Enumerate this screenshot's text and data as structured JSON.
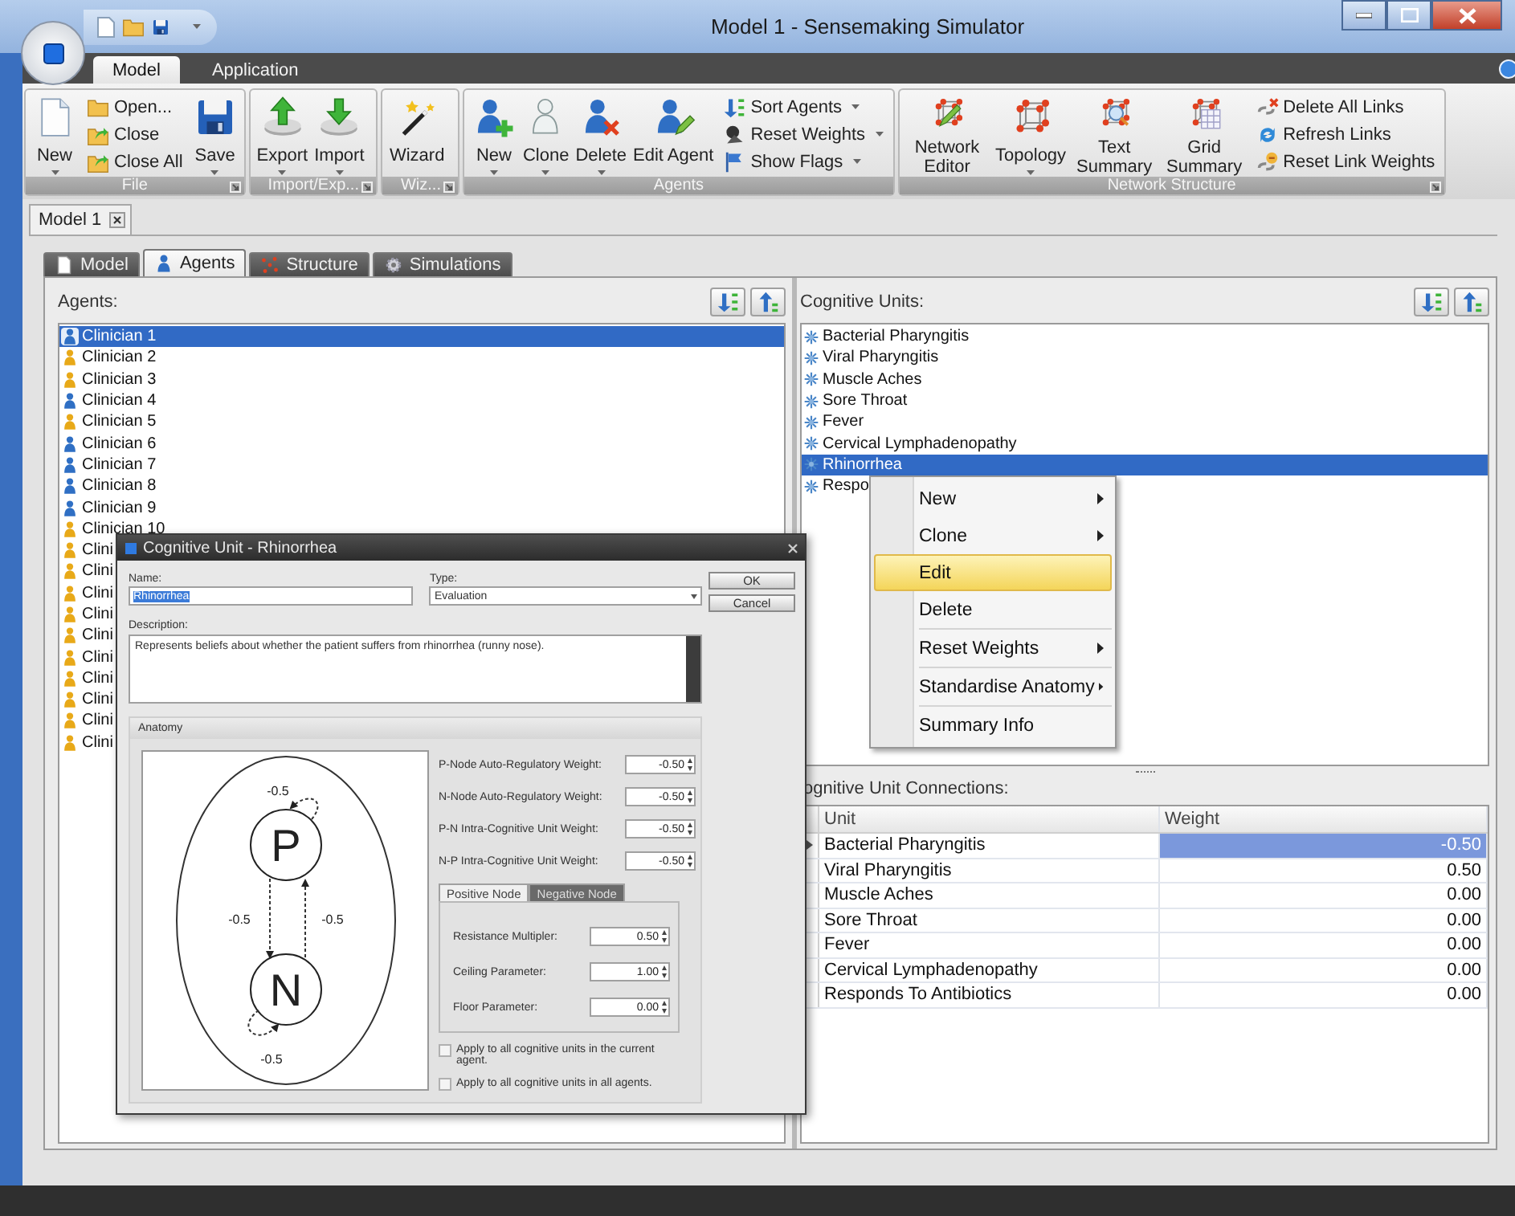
{
  "window": {
    "title": "Model 1 - Sensemaking Simulator"
  },
  "ribbon_tabs": [
    {
      "label": "Model",
      "selected": true
    },
    {
      "label": "Application",
      "selected": false
    }
  ],
  "ribbon_groups": [
    {
      "title": "File",
      "launcher": true,
      "items": [
        {
          "kind": "large",
          "label": "New",
          "dropdown": true
        },
        {
          "kind": "stack",
          "items": [
            {
              "label": "Open...",
              "dropdown": false
            },
            {
              "label": "Close",
              "dropdown": false
            },
            {
              "label": "Close All",
              "dropdown": false
            }
          ]
        },
        {
          "kind": "large",
          "label": "Save",
          "dropdown": true
        }
      ]
    },
    {
      "title": "Import/Exp...",
      "launcher": true,
      "items": [
        {
          "kind": "large",
          "label": "Export",
          "dropdown": true
        },
        {
          "kind": "large",
          "label": "Import",
          "dropdown": true
        }
      ]
    },
    {
      "title": "Wiz...",
      "launcher": true,
      "items": [
        {
          "kind": "large",
          "label": "Wizard",
          "dropdown": false
        }
      ]
    },
    {
      "title": "Agents",
      "launcher": false,
      "items": [
        {
          "kind": "large",
          "label": "New",
          "dropdown": true
        },
        {
          "kind": "large",
          "label": "Clone",
          "dropdown": true
        },
        {
          "kind": "large",
          "label": "Delete",
          "dropdown": true
        },
        {
          "kind": "large",
          "label": "Edit Agent",
          "dropdown": false
        },
        {
          "kind": "stack",
          "items": [
            {
              "label": "Sort Agents",
              "dropdown": true
            },
            {
              "label": "Reset Weights",
              "dropdown": true
            },
            {
              "label": "Show Flags",
              "dropdown": true
            }
          ]
        }
      ]
    },
    {
      "title": "Network Structure",
      "launcher": true,
      "items": [
        {
          "kind": "large",
          "label": "Network Editor",
          "dropdown": false
        },
        {
          "kind": "large",
          "label": "Topology",
          "dropdown": true
        },
        {
          "kind": "large",
          "label": "Text Summary",
          "dropdown": false
        },
        {
          "kind": "large",
          "label": "Grid Summary",
          "dropdown": false
        },
        {
          "kind": "stack",
          "items": [
            {
              "label": "Delete All Links",
              "dropdown": false
            },
            {
              "label": "Refresh Links",
              "dropdown": false
            },
            {
              "label": "Reset Link Weights",
              "dropdown": false
            }
          ]
        }
      ]
    }
  ],
  "document_tabs": [
    {
      "label": "Model 1",
      "selected": true
    }
  ],
  "view_tabs": [
    {
      "label": "Model",
      "selected": false
    },
    {
      "label": "Agents",
      "selected": true
    },
    {
      "label": "Structure",
      "selected": false
    },
    {
      "label": "Simulations",
      "selected": false
    }
  ],
  "agents": {
    "label": "Agents:",
    "items": [
      {
        "label": "Clinician 1",
        "color": "#2f6fc4",
        "selected": true
      },
      {
        "label": "Clinician 2",
        "color": "#e8a918",
        "selected": false
      },
      {
        "label": "Clinician 3",
        "color": "#e8a918",
        "selected": false
      },
      {
        "label": "Clinician 4",
        "color": "#2f6fc4",
        "selected": false
      },
      {
        "label": "Clinician 5",
        "color": "#e8a918",
        "selected": false
      },
      {
        "label": "Clinician 6",
        "color": "#2f6fc4",
        "selected": false
      },
      {
        "label": "Clinician 7",
        "color": "#2f6fc4",
        "selected": false
      },
      {
        "label": "Clinician 8",
        "color": "#2f6fc4",
        "selected": false
      },
      {
        "label": "Clinician 9",
        "color": "#2f6fc4",
        "selected": false
      },
      {
        "label": "Clinician 10",
        "color": "#e8a918",
        "selected": false
      },
      {
        "label": "Clini",
        "color": "#e8a918",
        "selected": false
      },
      {
        "label": "Clini",
        "color": "#e8a918",
        "selected": false
      },
      {
        "label": "Clini",
        "color": "#e8a918",
        "selected": false
      },
      {
        "label": "Clini",
        "color": "#e8a918",
        "selected": false
      },
      {
        "label": "Clini",
        "color": "#e8a918",
        "selected": false
      },
      {
        "label": "Clini",
        "color": "#e8a918",
        "selected": false
      },
      {
        "label": "Clini",
        "color": "#e8a918",
        "selected": false
      },
      {
        "label": "Clini",
        "color": "#e8a918",
        "selected": false
      },
      {
        "label": "Clini",
        "color": "#e8a918",
        "selected": false
      },
      {
        "label": "Clini",
        "color": "#e8a918",
        "selected": false
      }
    ]
  },
  "cognitive_units": {
    "label": "Cognitive Units:",
    "items": [
      {
        "label": "Bacterial Pharyngitis",
        "selected": false
      },
      {
        "label": "Viral Pharyngitis",
        "selected": false
      },
      {
        "label": "Muscle Aches",
        "selected": false
      },
      {
        "label": "Sore Throat",
        "selected": false
      },
      {
        "label": "Fever",
        "selected": false
      },
      {
        "label": "Cervical Lymphadenopathy",
        "selected": false
      },
      {
        "label": "Rhinorrhea",
        "selected": true
      },
      {
        "label": "Respo",
        "selected": false
      }
    ]
  },
  "connections": {
    "label": "ognitive Unit Connections:",
    "columns": [
      "Unit",
      "Weight"
    ],
    "rows": [
      {
        "unit": "Bacterial Pharyngitis",
        "weight": "-0.50",
        "selected": true
      },
      {
        "unit": "Viral Pharyngitis",
        "weight": "0.50",
        "selected": false
      },
      {
        "unit": "Muscle Aches",
        "weight": "0.00",
        "selected": false
      },
      {
        "unit": "Sore Throat",
        "weight": "0.00",
        "selected": false
      },
      {
        "unit": "Fever",
        "weight": "0.00",
        "selected": false
      },
      {
        "unit": "Cervical Lymphadenopathy",
        "weight": "0.00",
        "selected": false
      },
      {
        "unit": "Responds To Antibiotics",
        "weight": "0.00",
        "selected": false
      }
    ]
  },
  "context_menu": {
    "items": [
      {
        "label": "New",
        "submenu": true,
        "selected": false,
        "separator_before": false
      },
      {
        "label": "Clone",
        "submenu": true,
        "selected": false,
        "separator_before": false
      },
      {
        "label": "Edit",
        "submenu": false,
        "selected": true,
        "separator_before": false
      },
      {
        "label": "Delete",
        "submenu": false,
        "selected": false,
        "separator_before": false
      },
      {
        "label": "Reset Weights",
        "submenu": true,
        "selected": false,
        "separator_before": true
      },
      {
        "label": "Standardise Anatomy",
        "submenu": true,
        "selected": false,
        "separator_before": true
      },
      {
        "label": "Summary Info",
        "submenu": false,
        "selected": false,
        "separator_before": true
      }
    ]
  },
  "dialog": {
    "title": "Cognitive Unit - Rhinorrhea",
    "name": {
      "label": "Name:",
      "value": "Rhinorrhea",
      "highlighted": true
    },
    "type": {
      "label": "Type:",
      "value": "Evaluation"
    },
    "buttons": [
      "OK",
      "Cancel"
    ],
    "description": {
      "label": "Description:",
      "value": "Represents beliefs about whether the patient suffers from rhinorrhea (runny nose)."
    },
    "anatomy": {
      "title": "Anatomy",
      "diagram": {
        "p_label": "P",
        "n_label": "N",
        "p_self": "-0.5",
        "p_to_n": "-0.5",
        "n_to_p": "-0.5",
        "n_self": "-0.5"
      },
      "weights": [
        {
          "label": "P-Node Auto-Regulatory Weight:",
          "value": "-0.50"
        },
        {
          "label": "N-Node Auto-Regulatory Weight:",
          "value": "-0.50"
        },
        {
          "label": "P-N Intra-Cognitive Unit Weight:",
          "value": "-0.50"
        },
        {
          "label": "N-P Intra-Cognitive Unit Weight:",
          "value": "-0.50"
        }
      ],
      "node_tabs": [
        {
          "label": "Positive Node",
          "selected": true
        },
        {
          "label": "Negative Node",
          "selected": false
        }
      ],
      "parameters": [
        {
          "label": "Resistance Multipler:",
          "value": "0.50"
        },
        {
          "label": "Ceiling Parameter:",
          "value": "1.00"
        },
        {
          "label": "Floor Parameter:",
          "value": "0.00"
        }
      ],
      "options": [
        {
          "label": "Apply to all cognitive units in the current agent.",
          "checked": false
        },
        {
          "label": "Apply to all cognitive units in all agents.",
          "checked": false
        }
      ]
    }
  }
}
